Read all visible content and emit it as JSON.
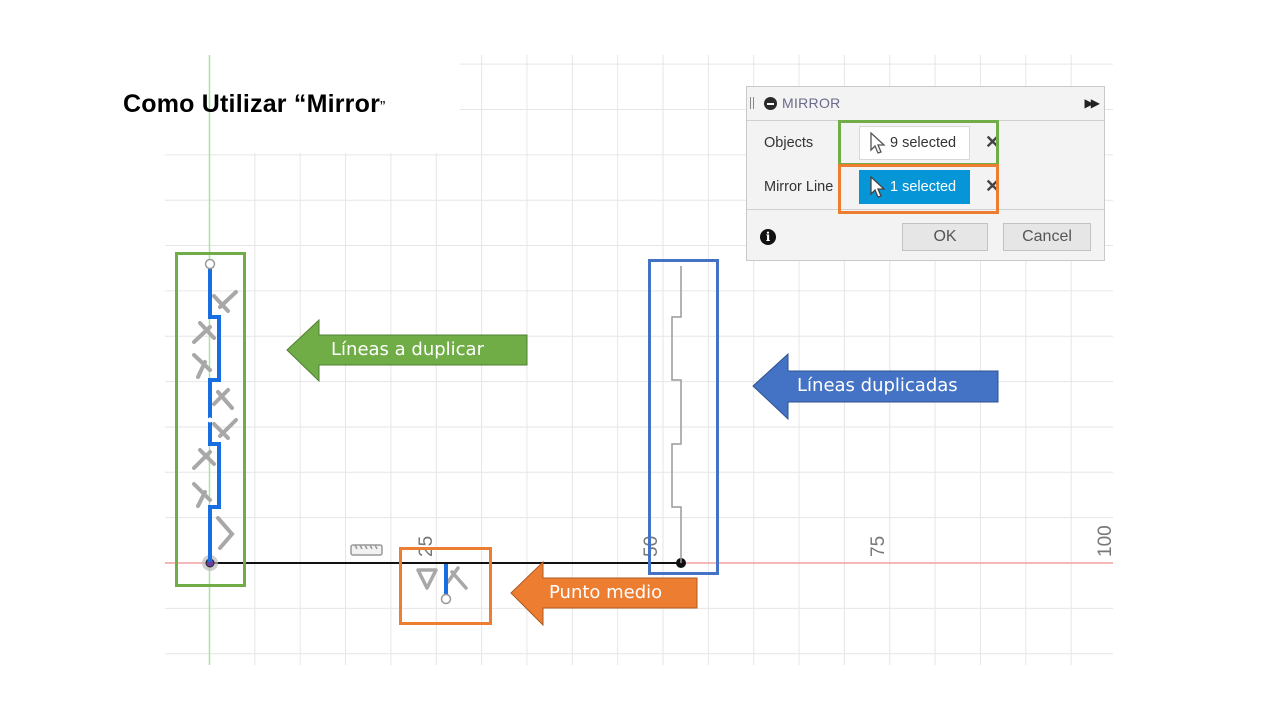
{
  "slide": {
    "title_main": "Como Utilizar “Mirror",
    "title_close_quote": "”"
  },
  "canvas": {
    "axis_tick_labels": [
      "25",
      "50",
      "75",
      "100"
    ],
    "colors": {
      "grid": "#e6e6e6",
      "x_axis": "#f0a0a0",
      "y_axis": "#a8e6a0",
      "selected_sketch": "#1a6fe0",
      "mirrored_sketch": "#9a9a9a",
      "sketch_line": "#111111"
    }
  },
  "dialog": {
    "title": "MIRROR",
    "rows": [
      {
        "label": "Objects",
        "value": "9 selected",
        "active": false
      },
      {
        "label": "Mirror Line",
        "value": "1 selected",
        "active": true
      }
    ],
    "ok_label": "OK",
    "cancel_label": "Cancel",
    "active_color": "#0696d7"
  },
  "callouts": {
    "green": {
      "text": "Líneas a duplicar",
      "color": "#70ad47"
    },
    "blue": {
      "text": "Líneas duplicadas",
      "color": "#4472c4"
    },
    "orange": {
      "text": "Punto medio",
      "color": "#ed7d31"
    }
  }
}
